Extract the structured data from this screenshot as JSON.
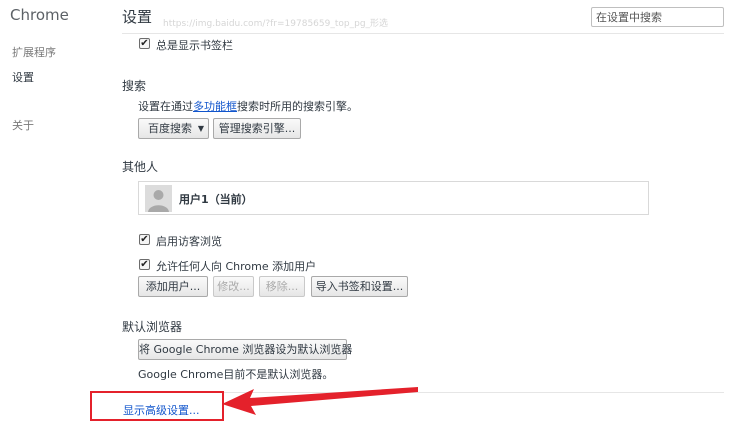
{
  "sidebar": {
    "brand": "Chrome",
    "items": [
      {
        "label": "扩展程序"
      },
      {
        "label": "设置"
      },
      {
        "label": "关于"
      }
    ]
  },
  "header": {
    "title": "设置",
    "search_placeholder": "在设置中搜索",
    "watermark": "https://img.baidu.com/?fr=19785659_top_pg_形选"
  },
  "appearance": {
    "show_bookmarks_bar": {
      "label": "总是显示书签栏",
      "checked": true
    }
  },
  "search": {
    "title": "搜索",
    "desc_prefix": "设置在通过",
    "desc_link": "多功能框",
    "desc_suffix": "搜索时所用的搜索引擎。",
    "engine_select": "百度搜索",
    "manage_button": "管理搜索引擎..."
  },
  "people": {
    "title": "其他人",
    "profile_name": "用户1（当前）",
    "guest_browsing": {
      "label": "启用访客浏览",
      "checked": true
    },
    "allow_add": {
      "label": "允许任何人向 Chrome 添加用户",
      "checked": true
    },
    "buttons": {
      "add": "添加用户...",
      "edit": "修改...",
      "remove": "移除...",
      "import": "导入书签和设置..."
    }
  },
  "default_browser": {
    "title": "默认浏览器",
    "button": "将 Google Chrome 浏览器设为默认浏览器",
    "status": "Google Chrome目前不是默认浏览器。"
  },
  "advanced": {
    "link": "显示高级设置..."
  },
  "annotation": {
    "color": "#e4212b"
  },
  "colors": {
    "link": "#1155cc",
    "text": "#303942"
  }
}
